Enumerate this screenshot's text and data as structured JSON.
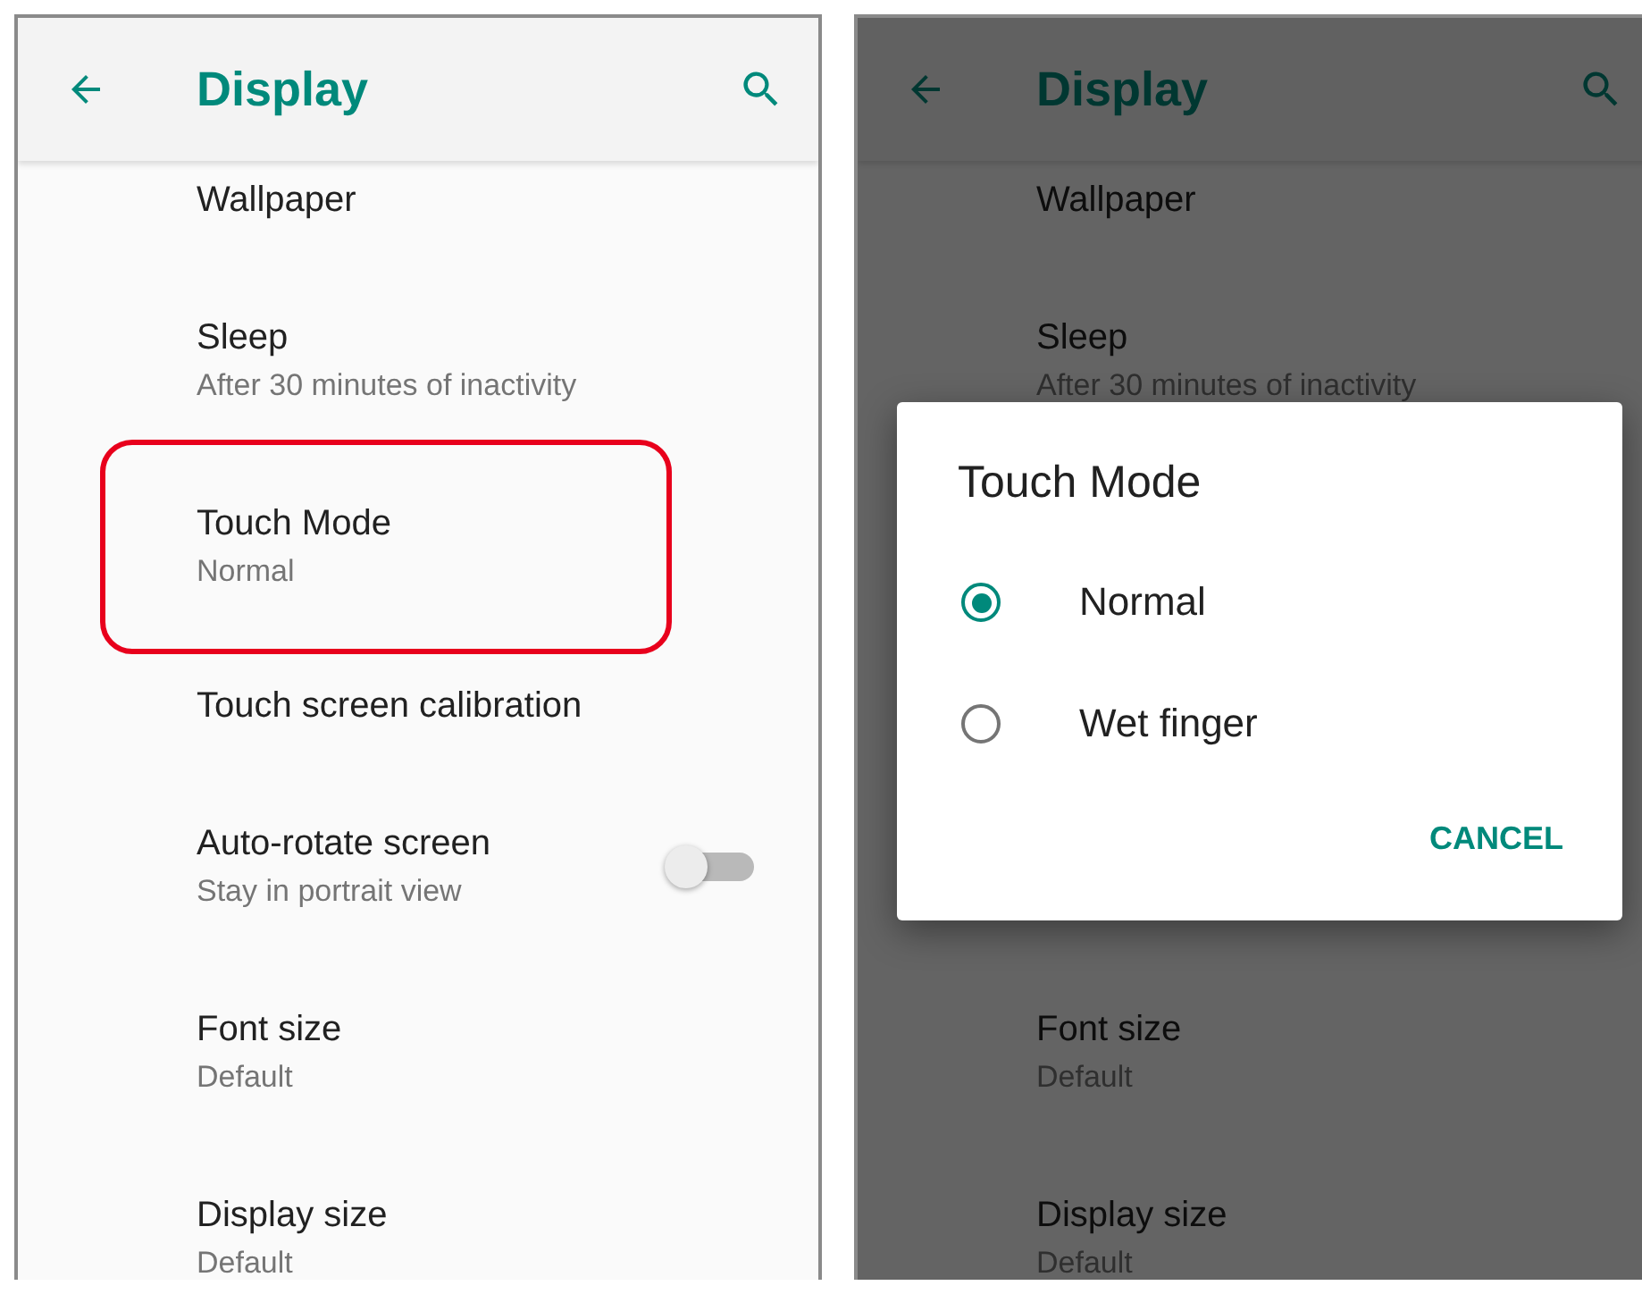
{
  "left_screen": {
    "app_bar": {
      "title": "Display"
    },
    "settings": [
      {
        "title": "Wallpaper",
        "highlighted": false
      },
      {
        "title": "Sleep",
        "summary": "After 30 minutes of inactivity",
        "highlighted": false
      },
      {
        "title": "Touch Mode",
        "summary": "Normal",
        "highlighted": true
      },
      {
        "title": "Touch screen calibration",
        "highlighted": false
      },
      {
        "title": "Auto-rotate screen",
        "summary": "Stay in portrait view",
        "kind": "toggle",
        "on": false,
        "highlighted": false
      },
      {
        "title": "Font size",
        "summary": "Default",
        "highlighted": false
      },
      {
        "title": "Display size",
        "summary": "Default",
        "highlighted": false
      }
    ]
  },
  "right_screen": {
    "app_bar": {
      "title": "Display"
    },
    "settings_above_dialog": [
      {
        "title": "Wallpaper"
      },
      {
        "title": "Sleep",
        "summary": "After 30 minutes of inactivity"
      }
    ],
    "settings_below_dialog": [
      {
        "title": "Font size",
        "summary": "Default"
      },
      {
        "title": "Display size",
        "summary": "Default"
      }
    ],
    "dialog": {
      "title": "Touch Mode",
      "options": [
        {
          "label": "Normal",
          "selected": true
        },
        {
          "label": "Wet finger",
          "selected": false
        }
      ],
      "buttons": [
        "CANCEL"
      ]
    }
  }
}
